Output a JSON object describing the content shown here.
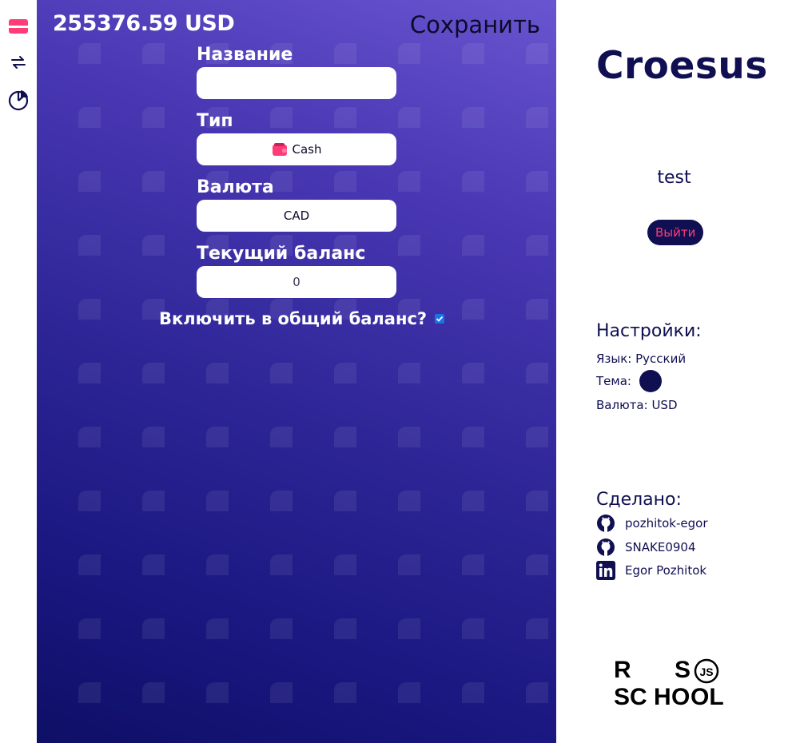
{
  "sidebar": {
    "items": [
      {
        "name": "accounts",
        "icon": "card-icon",
        "color": "#ff3c78"
      },
      {
        "name": "transactions",
        "icon": "arrows-exchange-icon",
        "color": "#0f0f52"
      },
      {
        "name": "statistics",
        "icon": "pie-chart-icon",
        "color": "#0f0f52"
      }
    ]
  },
  "header": {
    "total_balance": "255376.59 USD",
    "save_label": "Сохранить"
  },
  "form": {
    "name_label": "Название",
    "name_value": "",
    "type_label": "Тип",
    "type_value": "Cash",
    "type_icon": "wallet-icon",
    "currency_label": "Валюта",
    "currency_value": "CAD",
    "balance_label": "Текущий баланс",
    "balance_value": "0",
    "include_label": "Включить в общий баланс?",
    "include_checked": true
  },
  "right_panel": {
    "app_name": "Croesus",
    "username": "test",
    "logout_label": "Выйти",
    "settings_title": "Настройки:",
    "language": "Язык: Русский",
    "theme_label": "Тема:",
    "theme_color": "#0f0f52",
    "currency": "Валюта: USD",
    "made_by_title": "Сделано:",
    "credits": [
      {
        "label": "pozhitok-egor",
        "icon": "github-icon"
      },
      {
        "label": "SNAKE0904",
        "icon": "github-icon"
      },
      {
        "label": "Egor Pozhitok",
        "icon": "linkedin-icon"
      }
    ],
    "logo_text": {
      "line1_a": "R",
      "line1_b": "S",
      "line2_a": "SC",
      "line2_b": "H",
      "line2_c": "O",
      "line2_d": "OL",
      "badge": "JS"
    }
  },
  "colors": {
    "accent": "#ff3c78",
    "navy": "#0f0f52",
    "gradient_top": "#6a55d0",
    "gradient_bottom": "#0e0f66"
  }
}
